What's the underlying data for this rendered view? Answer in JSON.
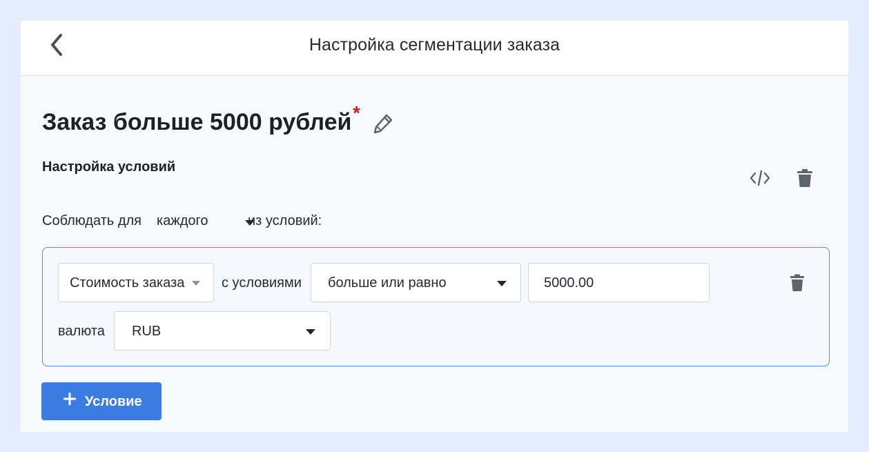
{
  "header": {
    "title": "Настройка сегментации заказа"
  },
  "segment": {
    "name": "Заказ больше 5000 рублей",
    "required_mark": "*"
  },
  "conditions_section": {
    "title": "Настройка условий",
    "match_prefix": "Соблюдать для",
    "match_value": "каждого",
    "match_suffix": "из условий:"
  },
  "condition": {
    "field": "Стоимость заказа",
    "operator_label": "с условиями",
    "operator": "больше или равно",
    "value": "5000.00",
    "currency_label": "валюта",
    "currency": "RUB"
  },
  "add_button": {
    "label": "Условие"
  },
  "colors": {
    "accent": "#3b7ce0",
    "required": "#d0202e",
    "border": "#4f8ee6"
  }
}
